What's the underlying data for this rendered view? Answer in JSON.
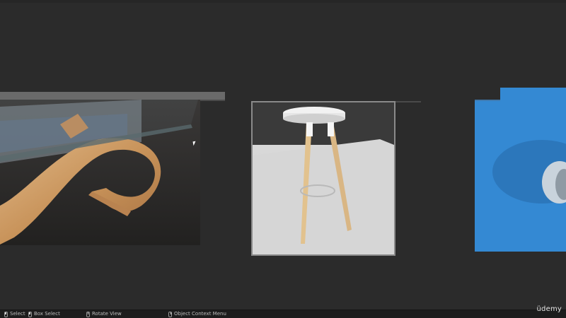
{
  "renders": [
    {
      "subject": "glass-top wooden wave coffee table"
    },
    {
      "subject": "white bar stool with wooden legs"
    },
    {
      "subject": "blue studio render"
    }
  ],
  "statusbar": {
    "select": "Select",
    "box_select": "Box Select",
    "rotate_view": "Rotate View",
    "context_menu": "Object Context Menu"
  },
  "watermark": "üdemy",
  "colors": {
    "background": "#2b2b2b",
    "statusbar": "#1d1d1d",
    "blue_render": "#3489d3"
  }
}
